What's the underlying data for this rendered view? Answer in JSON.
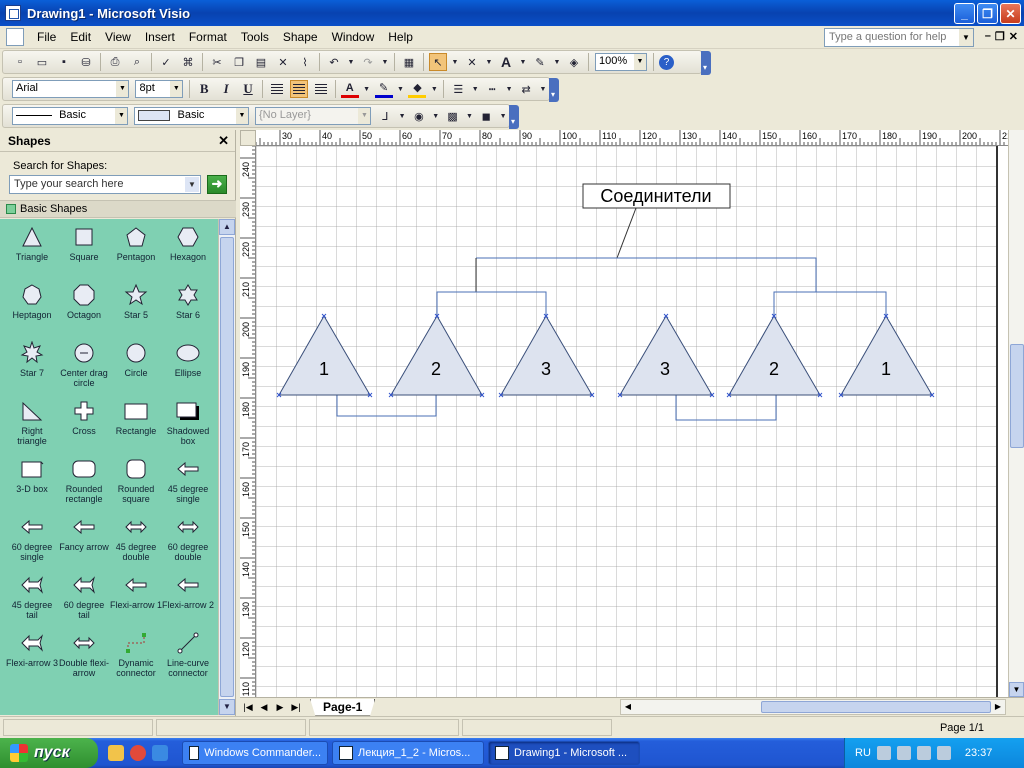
{
  "window": {
    "title": "Drawing1 - Microsoft Visio",
    "min": "_",
    "max": "❐",
    "close": "✕"
  },
  "menu": {
    "items": [
      "File",
      "Edit",
      "View",
      "Insert",
      "Format",
      "Tools",
      "Shape",
      "Window",
      "Help"
    ],
    "help_placeholder": "Type a question for help",
    "mdi_min": "–",
    "mdi_restore": "❐",
    "mdi_close": "✕"
  },
  "toolbar_standard": {
    "zoom": "100%"
  },
  "toolbar_format": {
    "font": "Arial",
    "size": "8pt"
  },
  "toolbar_style": {
    "line_style": "Basic",
    "fill_style": "Basic",
    "layer": "{No Layer}"
  },
  "shapes_pane": {
    "title": "Shapes",
    "search_label": "Search for Shapes:",
    "search_placeholder": "Type your search here",
    "stencil": "Basic Shapes",
    "shapes": [
      {
        "label": "Triangle",
        "icon": "triangle"
      },
      {
        "label": "Square",
        "icon": "square"
      },
      {
        "label": "Pentagon",
        "icon": "pentagon"
      },
      {
        "label": "Hexagon",
        "icon": "hexagon"
      },
      {
        "label": "Heptagon",
        "icon": "heptagon"
      },
      {
        "label": "Octagon",
        "icon": "octagon"
      },
      {
        "label": "Star 5",
        "icon": "star5"
      },
      {
        "label": "Star 6",
        "icon": "star6"
      },
      {
        "label": "Star 7",
        "icon": "star7"
      },
      {
        "label": "Center drag circle",
        "icon": "circle-dot"
      },
      {
        "label": "Circle",
        "icon": "circle"
      },
      {
        "label": "Ellipse",
        "icon": "ellipse"
      },
      {
        "label": "Right triangle",
        "icon": "right-triangle"
      },
      {
        "label": "Cross",
        "icon": "cross"
      },
      {
        "label": "Rectangle",
        "icon": "rectangle"
      },
      {
        "label": "Shadowed box",
        "icon": "shadow-box"
      },
      {
        "label": "3-D box",
        "icon": "box3d"
      },
      {
        "label": "Rounded rectangle",
        "icon": "rounded-rect"
      },
      {
        "label": "Rounded square",
        "icon": "rounded-square"
      },
      {
        "label": "45 degree single",
        "icon": "arrow-left"
      },
      {
        "label": "60 degree single",
        "icon": "arrow-left"
      },
      {
        "label": "Fancy arrow",
        "icon": "arrow-left"
      },
      {
        "label": "45 degree double",
        "icon": "arrow-double"
      },
      {
        "label": "60 degree double",
        "icon": "arrow-double"
      },
      {
        "label": "45 degree tail",
        "icon": "arrow-tail"
      },
      {
        "label": "60 degree tail",
        "icon": "arrow-tail"
      },
      {
        "label": "Flexi-arrow 1",
        "icon": "arrow-left"
      },
      {
        "label": "Flexi-arrow 2",
        "icon": "arrow-left"
      },
      {
        "label": "Flexi-arrow 3",
        "icon": "arrow-tail"
      },
      {
        "label": "Double flexi-arrow",
        "icon": "arrow-double"
      },
      {
        "label": "Dynamic connector",
        "icon": "dyn-connector"
      },
      {
        "label": "Line-curve connector",
        "icon": "line-connector"
      }
    ]
  },
  "rulers": {
    "h_labels": [
      "30",
      "40",
      "50",
      "60",
      "70",
      "80",
      "90",
      "100",
      "110",
      "120",
      "130",
      "140",
      "150",
      "160",
      "170",
      "180",
      "190",
      "200",
      "21"
    ],
    "v_labels": [
      "240",
      "230",
      "220",
      "210",
      "200",
      "190",
      "180",
      "170",
      "160",
      "150",
      "140",
      "130",
      "120",
      "110"
    ]
  },
  "diagram": {
    "callout": "Соединители",
    "triangles": [
      "1",
      "2",
      "3",
      "3",
      "2",
      "1"
    ]
  },
  "pagebar": {
    "tab": "Page-1"
  },
  "status": {
    "page": "Page 1/1"
  },
  "taskbar": {
    "start": "пуск",
    "tasks": [
      "Windows Commander...",
      "Лекция_1_2 - Micros...",
      "Drawing1 - Microsoft ..."
    ],
    "lang": "RU",
    "clock": "23:37"
  },
  "colors": {
    "title_bar": "#0a4fc8",
    "stencil_bg": "#7fd0b2",
    "shape_fill": "#dde3ef",
    "connector": "#4a6fb5"
  }
}
